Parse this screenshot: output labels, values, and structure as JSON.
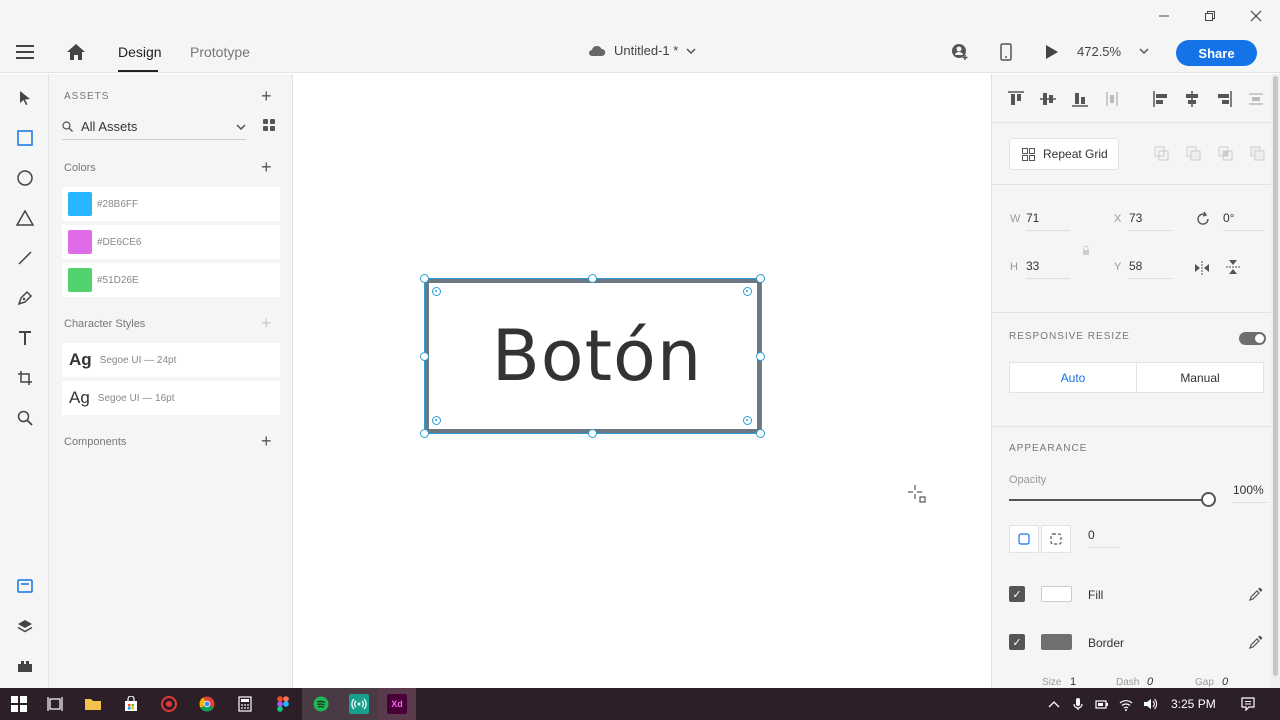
{
  "app": {
    "tabs": [
      {
        "label": "Design",
        "active": true
      },
      {
        "label": "Prototype",
        "active": false
      }
    ],
    "document_title": "Untitled-1 *",
    "zoom": "472.5%",
    "share_label": "Share"
  },
  "assets": {
    "heading": "ASSETS",
    "search_value": "All Assets",
    "colors_label": "Colors",
    "colors": [
      {
        "hex": "#28B6FF",
        "label": "#28B6FF"
      },
      {
        "hex": "#DE6CE6",
        "label": "#DE6CE6"
      },
      {
        "hex": "#51D26E",
        "label": "#51D26E"
      }
    ],
    "char_styles_label": "Character Styles",
    "char_styles": [
      {
        "sample": "Ag",
        "label": "Segoe UI — 24pt"
      },
      {
        "sample": "Ag",
        "label": "Segoe UI — 16pt"
      }
    ],
    "components_label": "Components"
  },
  "canvas": {
    "button_text": "Botón"
  },
  "inspector": {
    "repeat_grid_label": "Repeat Grid",
    "w_label": "W",
    "w_value": "71",
    "h_label": "H",
    "h_value": "33",
    "x_label": "X",
    "x_value": "73",
    "y_label": "Y",
    "y_value": "58",
    "rotation_value": "0°",
    "responsive_label": "RESPONSIVE RESIZE",
    "auto_label": "Auto",
    "manual_label": "Manual",
    "appearance_label": "APPEARANCE",
    "opacity_label": "Opacity",
    "opacity_value": "100%",
    "opacity_level": 1.0,
    "corner_radius_value": "0",
    "fill_label": "Fill",
    "fill_color": "#FFFFFF",
    "border_label": "Border",
    "border_color": "#707070",
    "size_label": "Size",
    "size_value": "1",
    "dash_label": "Dash",
    "dash_value": "0",
    "gap_label": "Gap",
    "gap_value": "0"
  },
  "taskbar": {
    "time": "3:25 PM"
  },
  "colors": {
    "accent": "#1473E6",
    "selection": "#2F9ED6",
    "taskbar": "#2D1F27"
  }
}
